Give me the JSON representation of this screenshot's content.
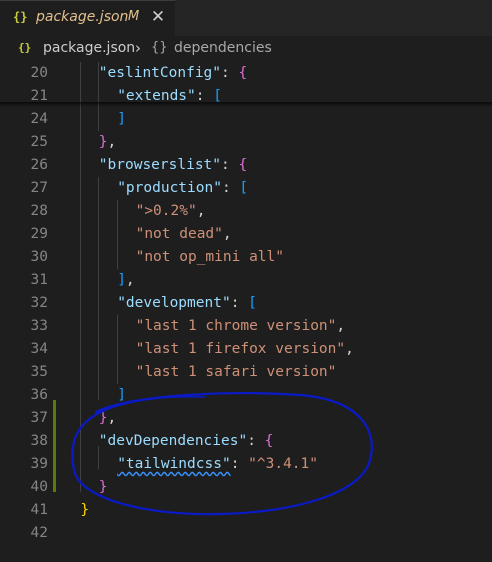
{
  "tab": {
    "icon": "json-braces-icon",
    "icon_text": "{}",
    "filename": "package.json",
    "status": "M",
    "close_glyph": "✕"
  },
  "breadcrumb": {
    "file_icon_text": "{}",
    "file": "package.json",
    "separator": "›",
    "symbol_icon_text": "{}",
    "symbol": "dependencies"
  },
  "editor": {
    "lines": [
      {
        "num": "20",
        "indent": "    ",
        "tokens": [
          {
            "t": "\"eslintConfig\"",
            "c": "k"
          },
          {
            "t": ": ",
            "c": "p"
          },
          {
            "t": "{",
            "c": "b2"
          }
        ]
      },
      {
        "num": "21",
        "indent": "      ",
        "tokens": [
          {
            "t": "\"extends\"",
            "c": "k"
          },
          {
            "t": ": ",
            "c": "p"
          },
          {
            "t": "[",
            "c": "b3"
          }
        ]
      },
      {
        "num": "24",
        "indent": "      ",
        "tokens": [
          {
            "t": "]",
            "c": "b3"
          }
        ]
      },
      {
        "num": "25",
        "indent": "    ",
        "tokens": [
          {
            "t": "}",
            "c": "b2"
          },
          {
            "t": ",",
            "c": "p"
          }
        ]
      },
      {
        "num": "26",
        "indent": "    ",
        "tokens": [
          {
            "t": "\"browserslist\"",
            "c": "k"
          },
          {
            "t": ": ",
            "c": "p"
          },
          {
            "t": "{",
            "c": "b2"
          }
        ]
      },
      {
        "num": "27",
        "indent": "      ",
        "tokens": [
          {
            "t": "\"production\"",
            "c": "k"
          },
          {
            "t": ": ",
            "c": "p"
          },
          {
            "t": "[",
            "c": "b3"
          }
        ]
      },
      {
        "num": "28",
        "indent": "        ",
        "tokens": [
          {
            "t": "\">0.2%\"",
            "c": "s"
          },
          {
            "t": ",",
            "c": "p"
          }
        ]
      },
      {
        "num": "29",
        "indent": "        ",
        "tokens": [
          {
            "t": "\"not dead\"",
            "c": "s"
          },
          {
            "t": ",",
            "c": "p"
          }
        ]
      },
      {
        "num": "30",
        "indent": "        ",
        "tokens": [
          {
            "t": "\"not op_mini all\"",
            "c": "s"
          }
        ]
      },
      {
        "num": "31",
        "indent": "      ",
        "tokens": [
          {
            "t": "]",
            "c": "b3"
          },
          {
            "t": ",",
            "c": "p"
          }
        ]
      },
      {
        "num": "32",
        "indent": "      ",
        "tokens": [
          {
            "t": "\"development\"",
            "c": "k"
          },
          {
            "t": ": ",
            "c": "p"
          },
          {
            "t": "[",
            "c": "b3"
          }
        ]
      },
      {
        "num": "33",
        "indent": "        ",
        "tokens": [
          {
            "t": "\"last 1 chrome version\"",
            "c": "s"
          },
          {
            "t": ",",
            "c": "p"
          }
        ]
      },
      {
        "num": "34",
        "indent": "        ",
        "tokens": [
          {
            "t": "\"last 1 firefox version\"",
            "c": "s"
          },
          {
            "t": ",",
            "c": "p"
          }
        ]
      },
      {
        "num": "35",
        "indent": "        ",
        "tokens": [
          {
            "t": "\"last 1 safari version\"",
            "c": "s"
          }
        ]
      },
      {
        "num": "36",
        "indent": "      ",
        "tokens": [
          {
            "t": "]",
            "c": "b3"
          }
        ]
      },
      {
        "num": "37",
        "indent": "    ",
        "tokens": [
          {
            "t": "}",
            "c": "b2"
          },
          {
            "t": ",",
            "c": "p"
          }
        ]
      },
      {
        "num": "38",
        "indent": "    ",
        "tokens": [
          {
            "t": "\"devDependencies\"",
            "c": "k"
          },
          {
            "t": ": ",
            "c": "p"
          },
          {
            "t": "{",
            "c": "b2"
          }
        ]
      },
      {
        "num": "39",
        "indent": "      ",
        "tokens": [
          {
            "t": "\"tailwindcss\"",
            "c": "k sq"
          },
          {
            "t": ": ",
            "c": "p"
          },
          {
            "t": "\"^3.4.1\"",
            "c": "s"
          }
        ]
      },
      {
        "num": "40",
        "indent": "    ",
        "tokens": [
          {
            "t": "}",
            "c": "b2"
          }
        ]
      },
      {
        "num": "41",
        "indent": "  ",
        "tokens": [
          {
            "t": "}",
            "c": "b1"
          }
        ]
      },
      {
        "num": "42",
        "indent": "",
        "tokens": []
      }
    ]
  },
  "colors": {
    "background": "#1e1e1e",
    "modified_tab": "#e2c08d",
    "json_icon": "#cbcb41",
    "property_key": "#9cdcfe",
    "string_value": "#ce9178",
    "bracket_level1": "#ffd700",
    "bracket_level2": "#da70d6",
    "bracket_level3": "#179fff",
    "git_added": "#587c0c",
    "annotation_ink": "#0a1ac8"
  }
}
